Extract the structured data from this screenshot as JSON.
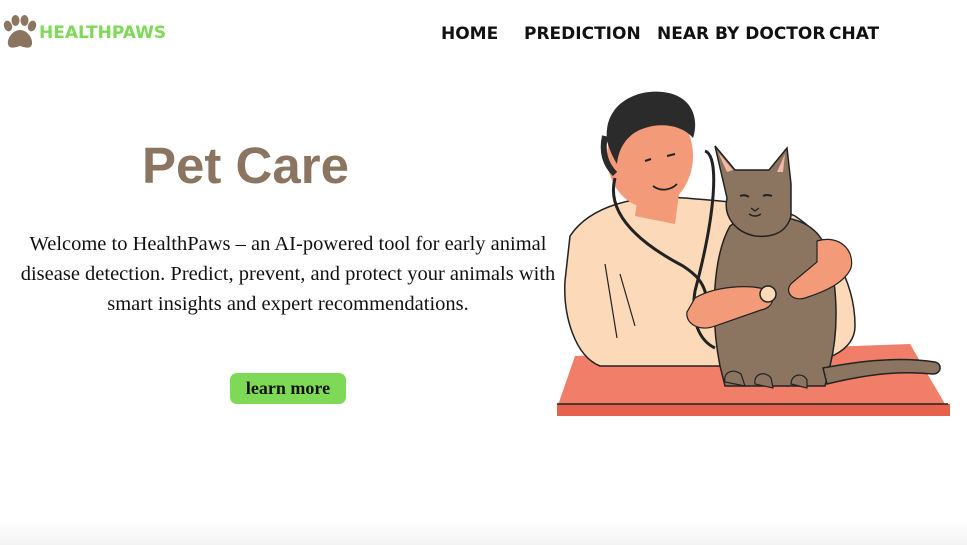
{
  "brand": {
    "name": "HEALTHPAWS",
    "logo_icon": "paw-icon",
    "brand_color": "#7ed957"
  },
  "nav": {
    "items": [
      "HOME",
      "PREDICTION",
      "NEAR BY DOCTOR",
      "CHAT"
    ]
  },
  "hero": {
    "title": "Pet Care",
    "description": "Welcome to HealthPaws – an AI-powered tool for early animal disease detection. Predict, prevent, and protect your animals with smart insights and expert recommendations.",
    "button_label": "learn more",
    "illustration": "vet-with-cat-illustration"
  },
  "colors": {
    "title": "#8b7560",
    "button": "#7ed957",
    "table": "#f07e68"
  }
}
